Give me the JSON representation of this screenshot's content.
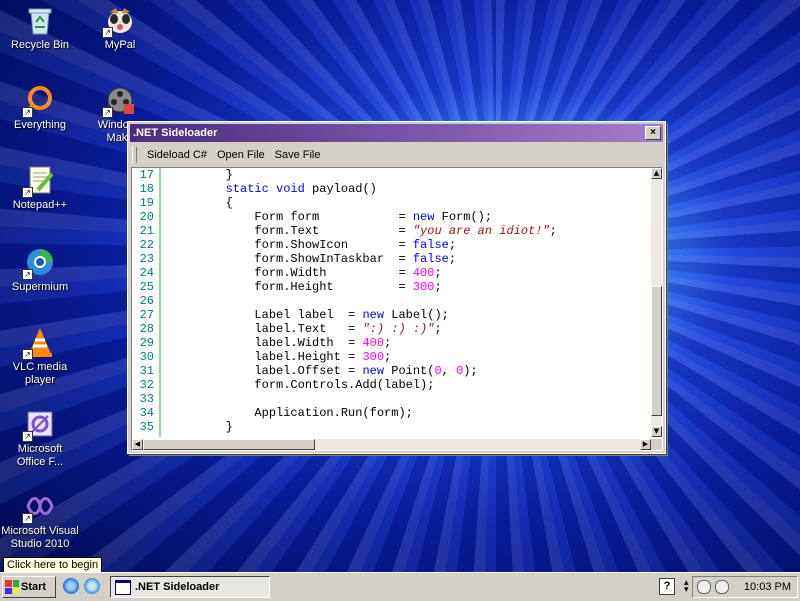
{
  "desktop": {
    "icons": [
      {
        "label": "Recycle Bin",
        "icon": "recycle-bin-icon"
      },
      {
        "label": "MyPal",
        "icon": "mypal-icon"
      },
      {
        "label": "Everything",
        "icon": "everything-icon"
      },
      {
        "label": "Windows Movie Maker",
        "icon": "movie-maker-icon"
      },
      {
        "label": "Notepad++",
        "icon": "notepadpp-icon"
      },
      {
        "label": "Supermium",
        "icon": "supermium-icon"
      },
      {
        "label": "VLC media player",
        "icon": "vlc-icon"
      },
      {
        "label": "Microsoft Office F...",
        "icon": "office-icon"
      },
      {
        "label": "Microsoft Visual Studio 2010",
        "icon": "visual-studio-icon"
      }
    ],
    "movie_maker_visible": "Windows\nMake"
  },
  "window": {
    "title": ".NET Sideloader",
    "close": "×",
    "menu": [
      "Sideload C#",
      "Open File",
      "Save File"
    ]
  },
  "code": {
    "lines": [
      {
        "n": "17",
        "text": "        }"
      },
      {
        "n": "18",
        "text": "        static void payload()"
      },
      {
        "n": "19",
        "text": "        {"
      },
      {
        "n": "20",
        "text": "            Form form           = new Form();"
      },
      {
        "n": "21",
        "text": "            form.Text           = \"you are an idiot!\";"
      },
      {
        "n": "22",
        "text": "            form.ShowIcon       = false;"
      },
      {
        "n": "23",
        "text": "            form.ShowInTaskbar  = false;"
      },
      {
        "n": "24",
        "text": "            form.Width          = 400;"
      },
      {
        "n": "25",
        "text": "            form.Height         = 300;"
      },
      {
        "n": "26",
        "text": ""
      },
      {
        "n": "27",
        "text": "            Label label  = new Label();"
      },
      {
        "n": "28",
        "text": "            label.Text   = \":) :) :)\";"
      },
      {
        "n": "29",
        "text": "            label.Width  = 400;"
      },
      {
        "n": "30",
        "text": "            label.Height = 300;"
      },
      {
        "n": "31",
        "text": "            label.Offset = new Point(0, 0);"
      },
      {
        "n": "32",
        "text": "            form.Controls.Add(label);"
      },
      {
        "n": "33",
        "text": ""
      },
      {
        "n": "34",
        "text": "            Application.Run(form);"
      },
      {
        "n": "35",
        "text": "        }"
      }
    ]
  },
  "taskbar": {
    "start_label": "Start",
    "tooltip": "Click here to begin",
    "task_label": ".NET Sideloader",
    "help": "?",
    "clock": "10:03 PM"
  },
  "colors": {
    "keyword": "#0000ff",
    "string": "#a31515",
    "number": "#ff00ff",
    "line_number": "#008080",
    "title_gradient_start": "#4b2b7e",
    "title_gradient_end": "#a37dc9"
  }
}
